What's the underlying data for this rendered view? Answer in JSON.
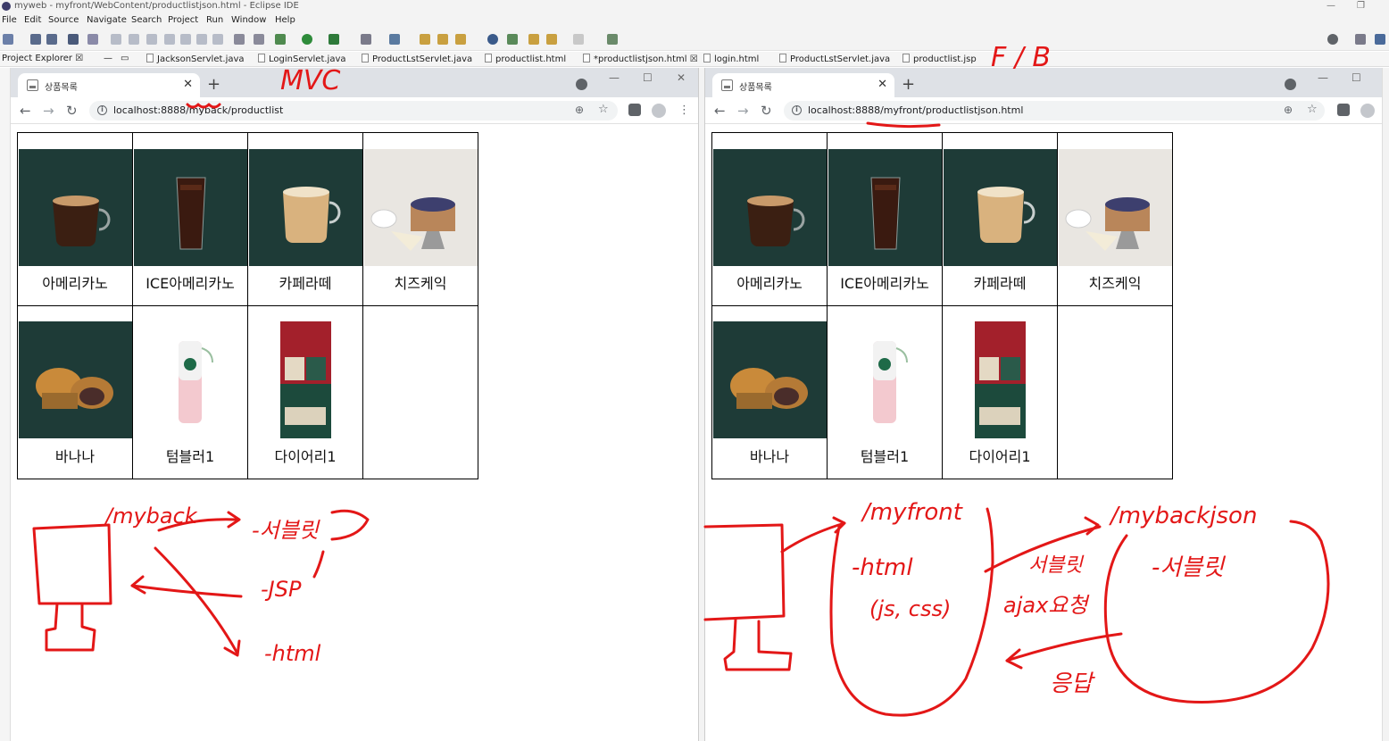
{
  "eclipse": {
    "window_title": "myweb - myfront/WebContent/productlistjson.html - Eclipse IDE",
    "menus": [
      "File",
      "Edit",
      "Source",
      "Navigate",
      "Search",
      "Project",
      "Run",
      "Window",
      "Help"
    ],
    "project_explorer_label": "Project Explorer",
    "editor_tabs": [
      "JacksonServlet.java",
      "LoginServlet.java",
      "ProductLstServlet.java",
      "productlist.html",
      "*productlistjson.html",
      "login.html",
      "ProductLstServlet.java",
      "productlist.jsp"
    ]
  },
  "left_browser": {
    "tab_title": "상품목록",
    "url": "localhost:8888/myback/productlist",
    "products_row1": [
      "아메리카노",
      "ICE아메리카노",
      "카페라떼",
      "치즈케익"
    ],
    "products_row2": [
      "바나나",
      "텀블러1",
      "다이어리1",
      ""
    ]
  },
  "right_browser": {
    "tab_title": "상품목록",
    "url": "localhost:8888/myfront/productlistjson.html",
    "products_row1": [
      "아메리카노",
      "ICE아메리카노",
      "카페라떼",
      "치즈케익"
    ],
    "products_row2": [
      "바나나",
      "텀블러1",
      "다이어리1",
      ""
    ]
  },
  "annotations": {
    "mvc": "MVC",
    "fb": "F / B",
    "left_myback": "/myback",
    "left_servlet": "-서블릿",
    "left_jsp": "-JSP",
    "left_html": "-html",
    "right_myfront": "/myfront",
    "right_html": "-html",
    "right_jscss": "(js, css)",
    "right_servlet_ajax": "서블릿",
    "right_ajax": "ajax요청",
    "right_response": "응답",
    "right_mybackjson": "/mybackjson",
    "right_servlet": "-서블릿"
  },
  "colors": {
    "annotation_red": "#e31717",
    "product_bg_dark_green": "#1e3b37",
    "tab_strip": "#dee1e6"
  }
}
